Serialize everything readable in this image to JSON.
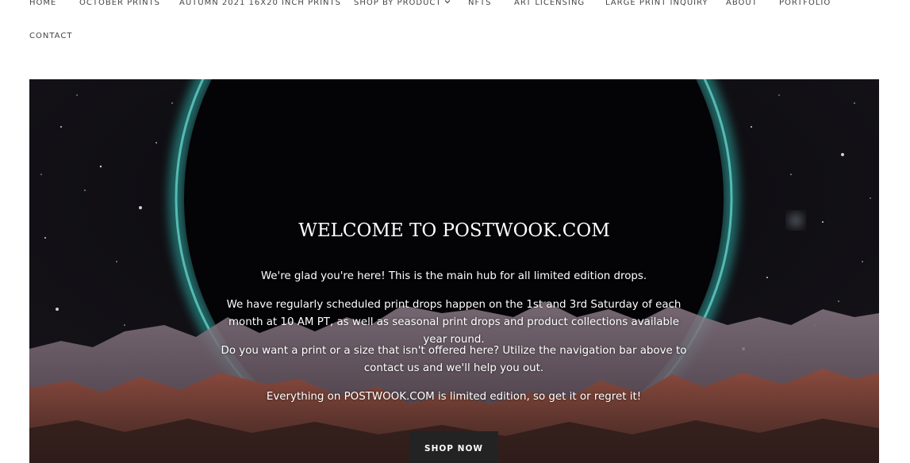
{
  "nav": {
    "items": [
      {
        "label": "HOME"
      },
      {
        "label": "OCTOBER PRINTS"
      },
      {
        "label": "AUTUMN 2021 16X20 INCH PRINTS"
      },
      {
        "label": "SHOP BY PRODUCT",
        "icon": "chevron-down-icon"
      },
      {
        "label": "NFTS"
      },
      {
        "label": "ART LICENSING"
      },
      {
        "label": "LARGE PRINT INQUIRY"
      },
      {
        "label": "ABOUT"
      },
      {
        "label": "PORTFOLIO"
      },
      {
        "label": "CONTACT"
      }
    ]
  },
  "hero": {
    "title": "WELCOME TO POSTWOOK.COM",
    "paragraphs": [
      "We're glad you're here! This is the main hub for all limited edition drops.",
      "We have regularly scheduled print drops happen on the 1st and 3rd Saturday of each month at 10 AM PT, as well as seasonal print drops and product collections available year round.",
      "Do you want a print or a size that isn't offered here? Utilize the navigation bar above to contact us and we'll help you out.",
      "Everything on POSTWOOK.COM is limited edition, so get it or regret it!"
    ],
    "button_label": "SHOP NOW"
  },
  "colors": {
    "ring": "#2fb5ad",
    "sky": "#050407",
    "mountains": "#6b5560",
    "rocks": "#7a3f36",
    "button": "#232323"
  }
}
